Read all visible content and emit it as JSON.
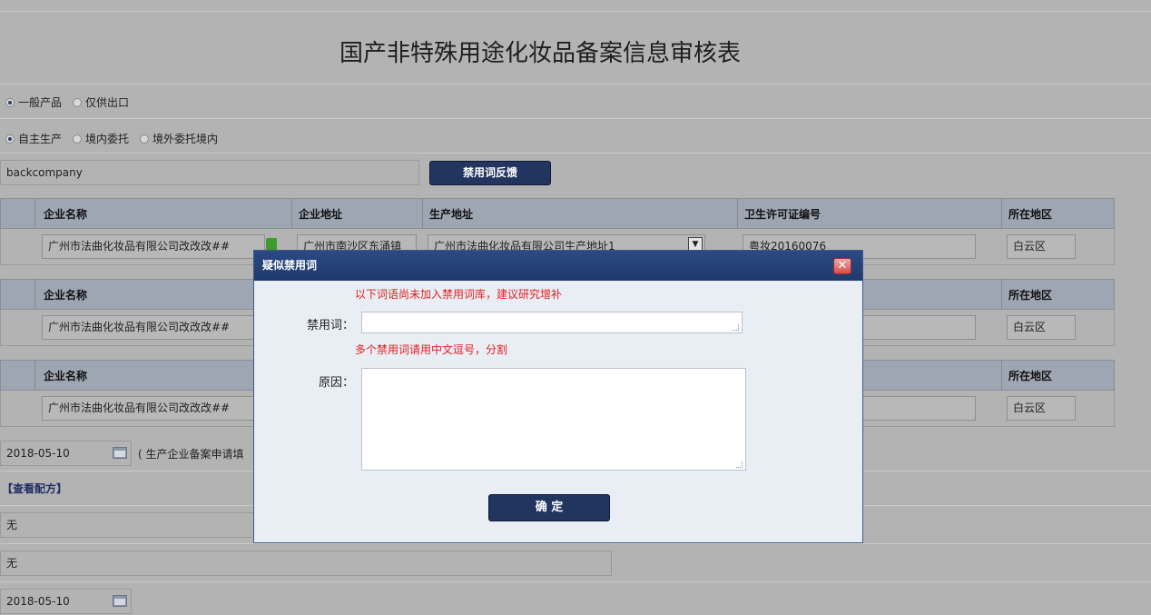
{
  "page_title": "国产非特殊用途化妆品备案信息审核表",
  "product_type": {
    "options": [
      {
        "label": "一般产品",
        "selected": true
      },
      {
        "label": "仅供出口",
        "selected": false
      }
    ]
  },
  "production_type": {
    "options": [
      {
        "label": "自主生产",
        "selected": true
      },
      {
        "label": "境内委托",
        "selected": false
      },
      {
        "label": "境外委托境内",
        "selected": false
      }
    ]
  },
  "company_field": {
    "value": "backcompany"
  },
  "forbidden_feedback_button": "禁用词反馈",
  "table_headers": {
    "company_name": "企业名称",
    "company_address": "企业地址",
    "production_address": "生产地址",
    "license_no": "卫生许可证编号",
    "region": "所在地区"
  },
  "rows": [
    {
      "company_name": "广州市法曲化妆品有限公司改改改##",
      "company_address": "广州市南沙区东涌镇",
      "production_address": "广州市法曲化妆品有限公司生产地址1",
      "license_no": "粤妆20160076",
      "region": "白云区"
    },
    {
      "company_name": "广州市法曲化妆品有限公司改改改##",
      "region": "白云区"
    },
    {
      "company_name": "广州市法曲化妆品有限公司改改改##",
      "region": "白云区"
    }
  ],
  "date_field_1": {
    "value": "2018-05-10",
    "note": "( 生产企业备案申请填"
  },
  "view_formula_link": "【查看配方】",
  "field_none_1": "无",
  "field_none_2": "无",
  "date_field_2": {
    "value": "2018-05-10"
  },
  "modal": {
    "title": "疑似禁用词",
    "notice": "以下词语尚未加入禁用词库，建议研究增补",
    "forbidden_word_label": "禁用词：",
    "forbidden_word_value": "",
    "hint": "多个禁用词请用中文逗号，分割",
    "reason_label": "原因：",
    "reason_value": "",
    "confirm_button": "确 定"
  },
  "colors": {
    "background": "#b3b3b3",
    "button_dark": "#22355f",
    "modal_title": "#203a6c",
    "red_text": "#e02020"
  }
}
